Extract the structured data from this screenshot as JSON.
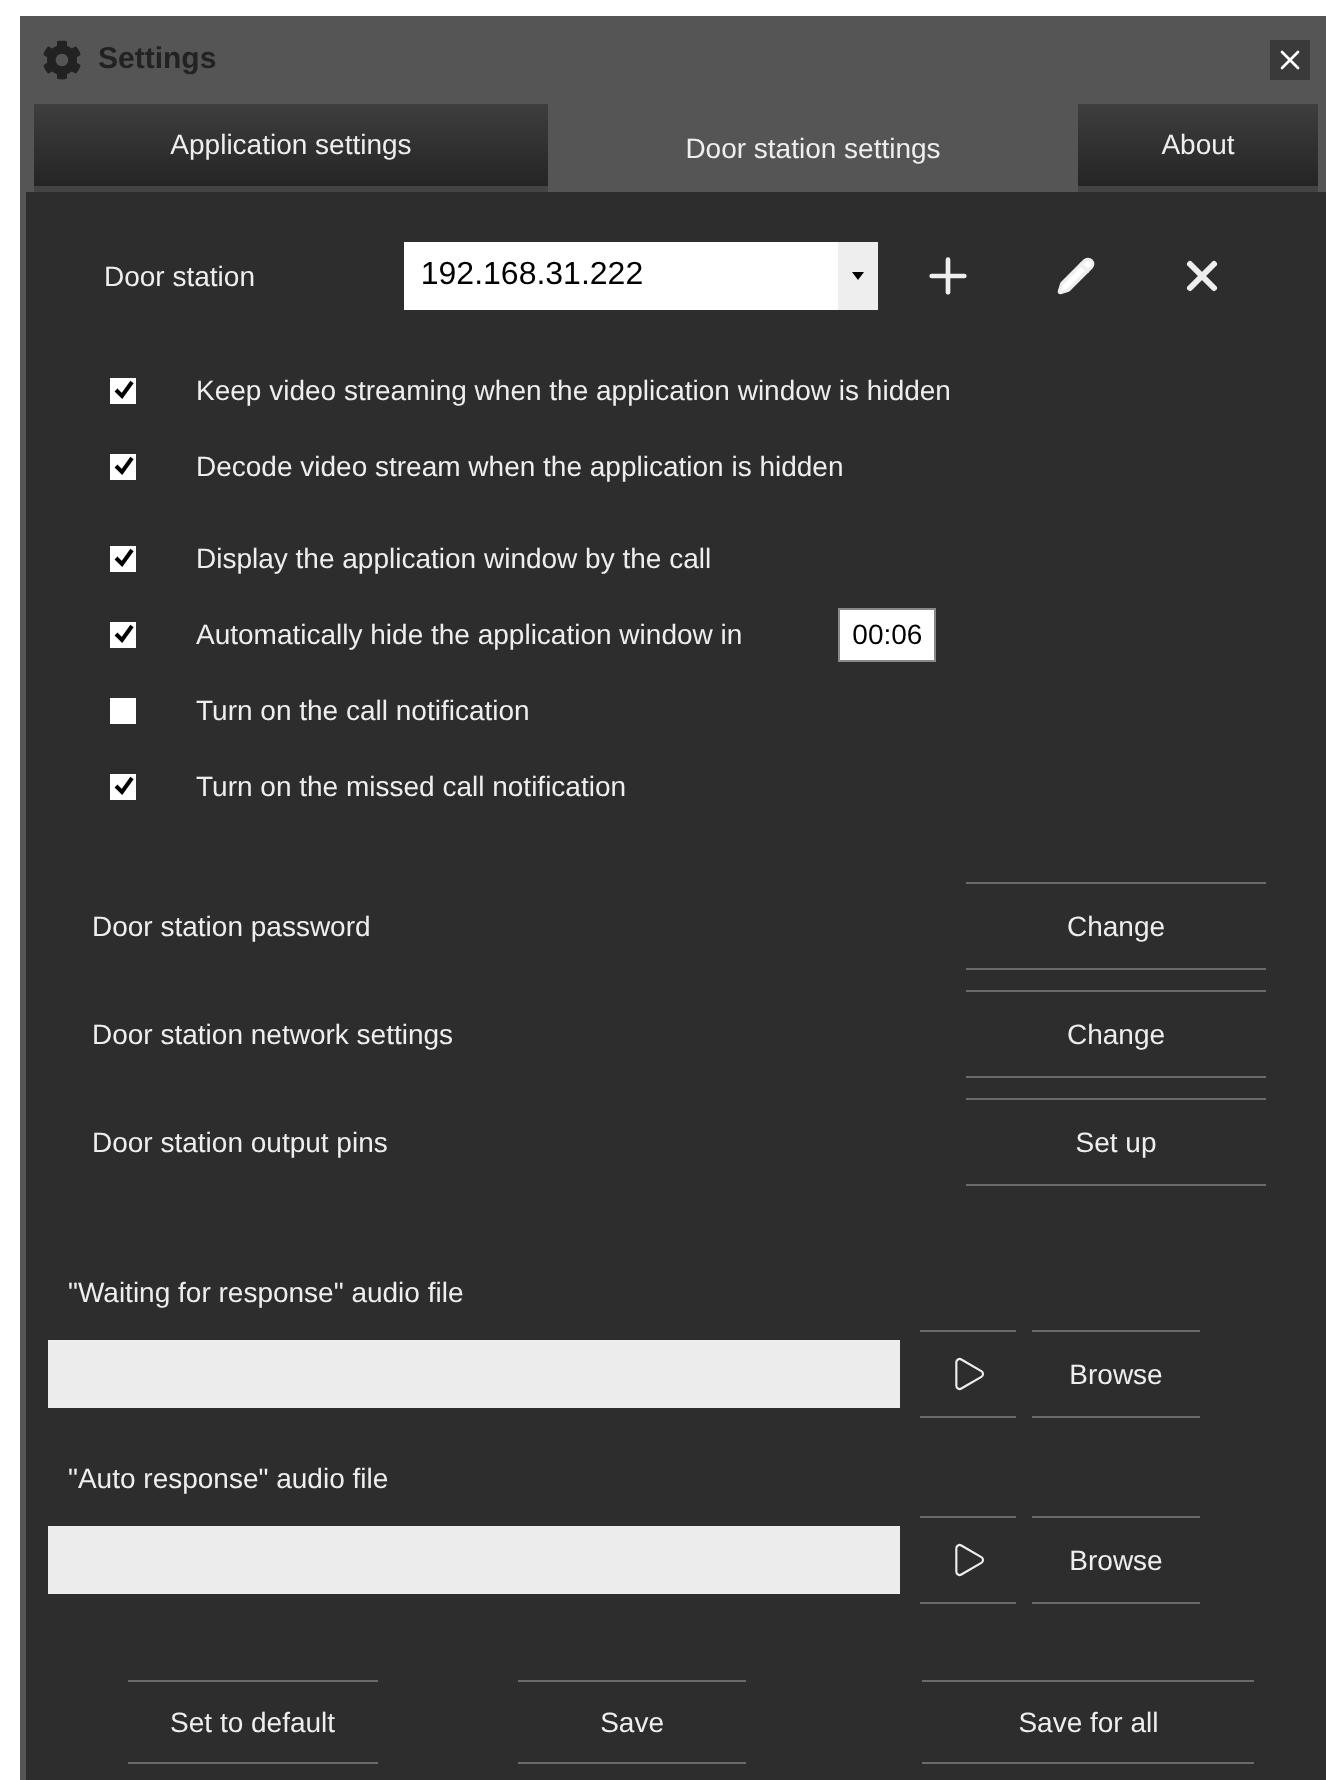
{
  "window": {
    "title": "Settings"
  },
  "tabs": [
    {
      "label": "Application settings",
      "selected": false
    },
    {
      "label": "Door station settings",
      "selected": true
    },
    {
      "label": "About",
      "selected": false
    }
  ],
  "door_station": {
    "label": "Door station",
    "value": "192.168.31.222"
  },
  "options": [
    {
      "label": "Keep video streaming when the application window is hidden",
      "checked": true
    },
    {
      "label": "Decode video stream when the application is hidden",
      "checked": true
    },
    {
      "label": "Display the application window by the call",
      "checked": true
    },
    {
      "label": "Automatically hide the application window in",
      "checked": true,
      "time": "00:06"
    },
    {
      "label": "Turn on the call notification",
      "checked": false
    },
    {
      "label": "Turn on the missed call notification",
      "checked": true
    }
  ],
  "actions": [
    {
      "label": "Door station password",
      "button": "Change"
    },
    {
      "label": "Door station network settings",
      "button": "Change"
    },
    {
      "label": "Door station output pins",
      "button": "Set up"
    }
  ],
  "audio_files": [
    {
      "label": "\"Waiting for response\" audio file",
      "button": "Browse"
    },
    {
      "label": "\"Auto response\" audio file",
      "button": "Browse"
    }
  ],
  "footer_buttons": [
    "Set to default",
    "Save",
    "Save for all"
  ]
}
